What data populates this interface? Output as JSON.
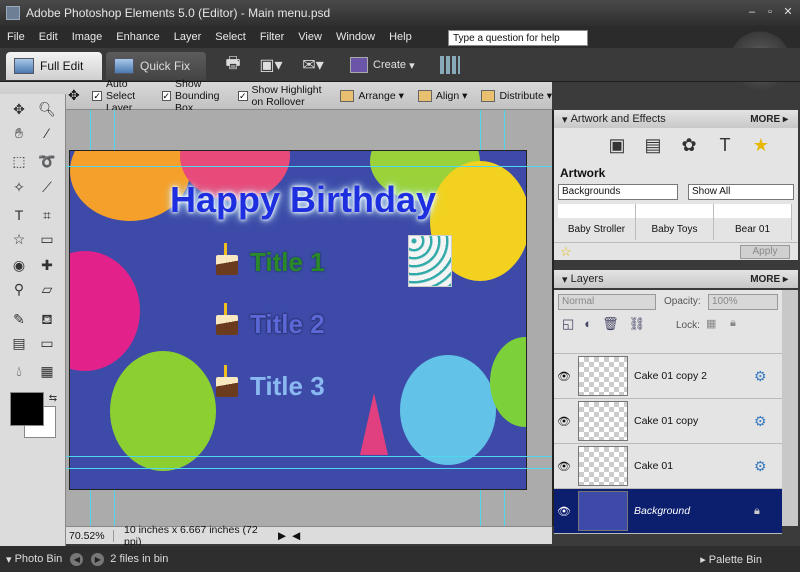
{
  "window": {
    "title": "Adobe Photoshop Elements 5.0 (Editor) - Main menu.psd"
  },
  "menu": [
    "File",
    "Edit",
    "Image",
    "Enhance",
    "Layer",
    "Select",
    "Filter",
    "View",
    "Window",
    "Help"
  ],
  "help_search": {
    "placeholder": "Type a question for help"
  },
  "modes": {
    "full_edit": "Full Edit",
    "quick_fix": "Quick Fix",
    "create": "Create"
  },
  "options": {
    "auto_select": "Auto Select Layer",
    "bounding_box": "Show Bounding Box",
    "highlight": "Show Highlight on Rollover",
    "arrange": "Arrange",
    "align": "Align",
    "distribute": "Distribute"
  },
  "canvas": {
    "heading": "Happy Birthday",
    "title1": "Title 1",
    "title2": "Title 2",
    "title3": "Title 3"
  },
  "status": {
    "zoom": "70.52%",
    "dimensions": "10 inches x 6.667 inches (72 ppi)"
  },
  "artwork_panel": {
    "header": "Artwork and Effects",
    "more": "MORE",
    "section_title": "Artwork",
    "category": "Backgrounds",
    "filter": "Show All",
    "thumbs": [
      "Baby Stroller",
      "Baby Toys",
      "Bear 01"
    ],
    "apply": "Apply"
  },
  "layers_panel": {
    "header": "Layers",
    "more": "MORE",
    "blend_mode": "Normal",
    "opacity_label": "Opacity:",
    "opacity": "100%",
    "lock_label": "Lock:",
    "layers": [
      "Cake 01 copy 2",
      "Cake 01 copy",
      "Cake 01",
      "Background"
    ]
  },
  "bottom": {
    "photo_bin": "Photo Bin",
    "files": "2 files in bin",
    "palette_bin": "Palette Bin"
  },
  "colors": {
    "canvas_bg": "#3d4aa8",
    "selected_layer": "#0c1e6e",
    "guide": "#4dd8f0"
  }
}
